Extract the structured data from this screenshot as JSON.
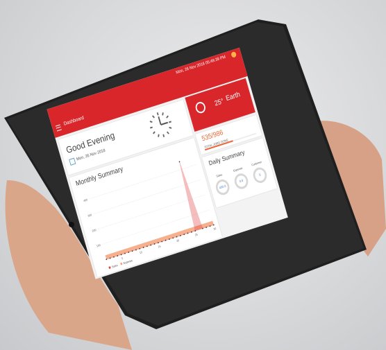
{
  "appbar": {
    "title": "Dashboard",
    "datetime": "Mon, 26 Nov 2018   05:49:39 PM"
  },
  "greeting": {
    "title": "Good Evening",
    "date": "Mon, 26 Nov 2018"
  },
  "weather": {
    "temperature": "25°",
    "place": "Earth"
  },
  "jobs": {
    "value": "535/986",
    "label": "TOTAL JOBS DONE",
    "progress": 0.54
  },
  "daily_summary": {
    "title": "Daily Summary",
    "items": [
      {
        "label": "Sales",
        "value": "450.0"
      },
      {
        "label": "Expense",
        "value": "0.0"
      },
      {
        "label": "Customer",
        "value": "0"
      }
    ]
  },
  "monthly": {
    "title": "Monthly Summary"
  },
  "chart_data": {
    "type": "area",
    "x": [
      1,
      2,
      3,
      4,
      5,
      6,
      7,
      8,
      9,
      10,
      11,
      12,
      13,
      14,
      15,
      16,
      17,
      18,
      19,
      20,
      21,
      22,
      23,
      24,
      25,
      26,
      27,
      28,
      29,
      30
    ],
    "x_ticks": [
      "5",
      "10",
      "15",
      "20",
      "25",
      "30"
    ],
    "y_ticks": [
      "100",
      "200",
      "300",
      "400"
    ],
    "ylim": [
      0,
      450
    ],
    "series": [
      {
        "name": "Sales",
        "color": "#e04646",
        "values": [
          0,
          0,
          0,
          0,
          0,
          0,
          0,
          0,
          0,
          0,
          0,
          0,
          0,
          0,
          0,
          0,
          0,
          0,
          0,
          0,
          0,
          0,
          0,
          0,
          0,
          450,
          0,
          0,
          0,
          0
        ]
      },
      {
        "name": "Expense",
        "color": "#f4a27a",
        "values": [
          0,
          0,
          0,
          0,
          0,
          0,
          0,
          0,
          0,
          0,
          0,
          0,
          0,
          0,
          0,
          0,
          0,
          0,
          0,
          0,
          0,
          0,
          0,
          0,
          0,
          0,
          0,
          0,
          0,
          0
        ]
      }
    ],
    "legend": "bottom-left"
  }
}
